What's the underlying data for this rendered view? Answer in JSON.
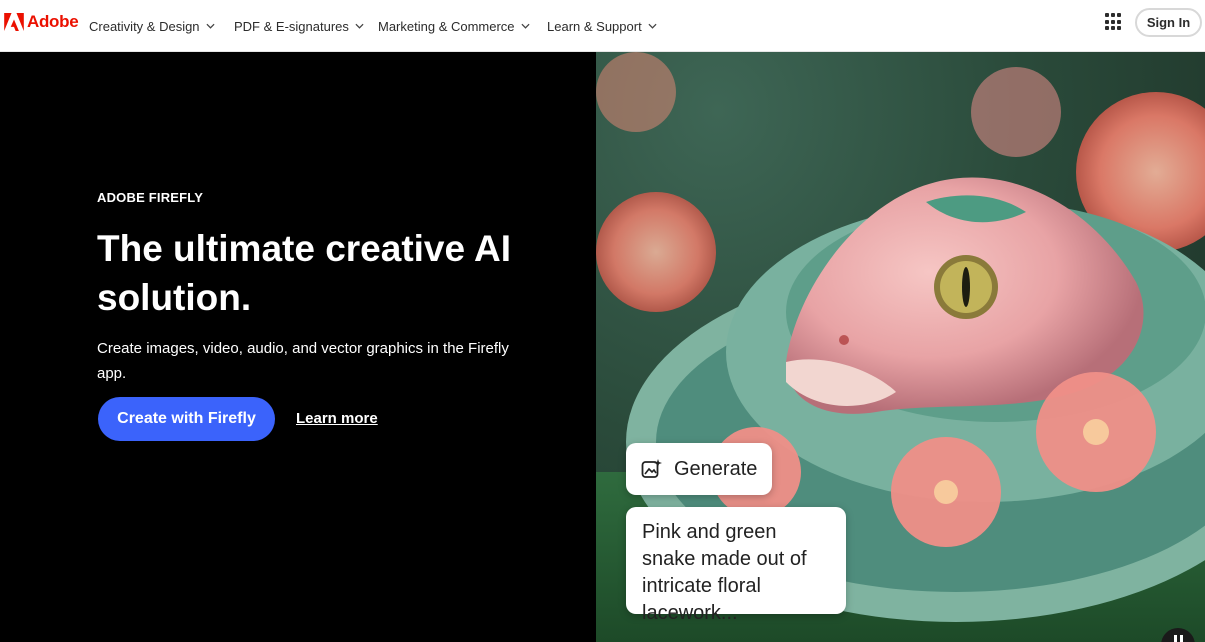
{
  "brand": {
    "name": "Adobe",
    "color": "#eb1000"
  },
  "nav": {
    "items": [
      {
        "label": "Creativity & Design"
      },
      {
        "label": "PDF & E-signatures"
      },
      {
        "label": "Marketing & Commerce"
      },
      {
        "label": "Learn & Support"
      }
    ],
    "apps_icon": "grid-icon",
    "signin_label": "Sign In"
  },
  "hero": {
    "eyebrow": "ADOBE FIREFLY",
    "headline": "The ultimate creative AI solution.",
    "subtext": "Create images, video, audio, and vector graphics in the Firefly app.",
    "cta_primary": "Create with Firefly",
    "cta_secondary": "Learn more",
    "cta_color": "#3b63fb"
  },
  "showcase": {
    "image_alt": "Pink and green snake made out of intricate floral lacework",
    "generate_label": "Generate",
    "generate_icon": "sparkle-image-icon",
    "prompt": "Pink and green snake made out of intricate floral lacework...",
    "pause_icon": "pause-icon"
  }
}
